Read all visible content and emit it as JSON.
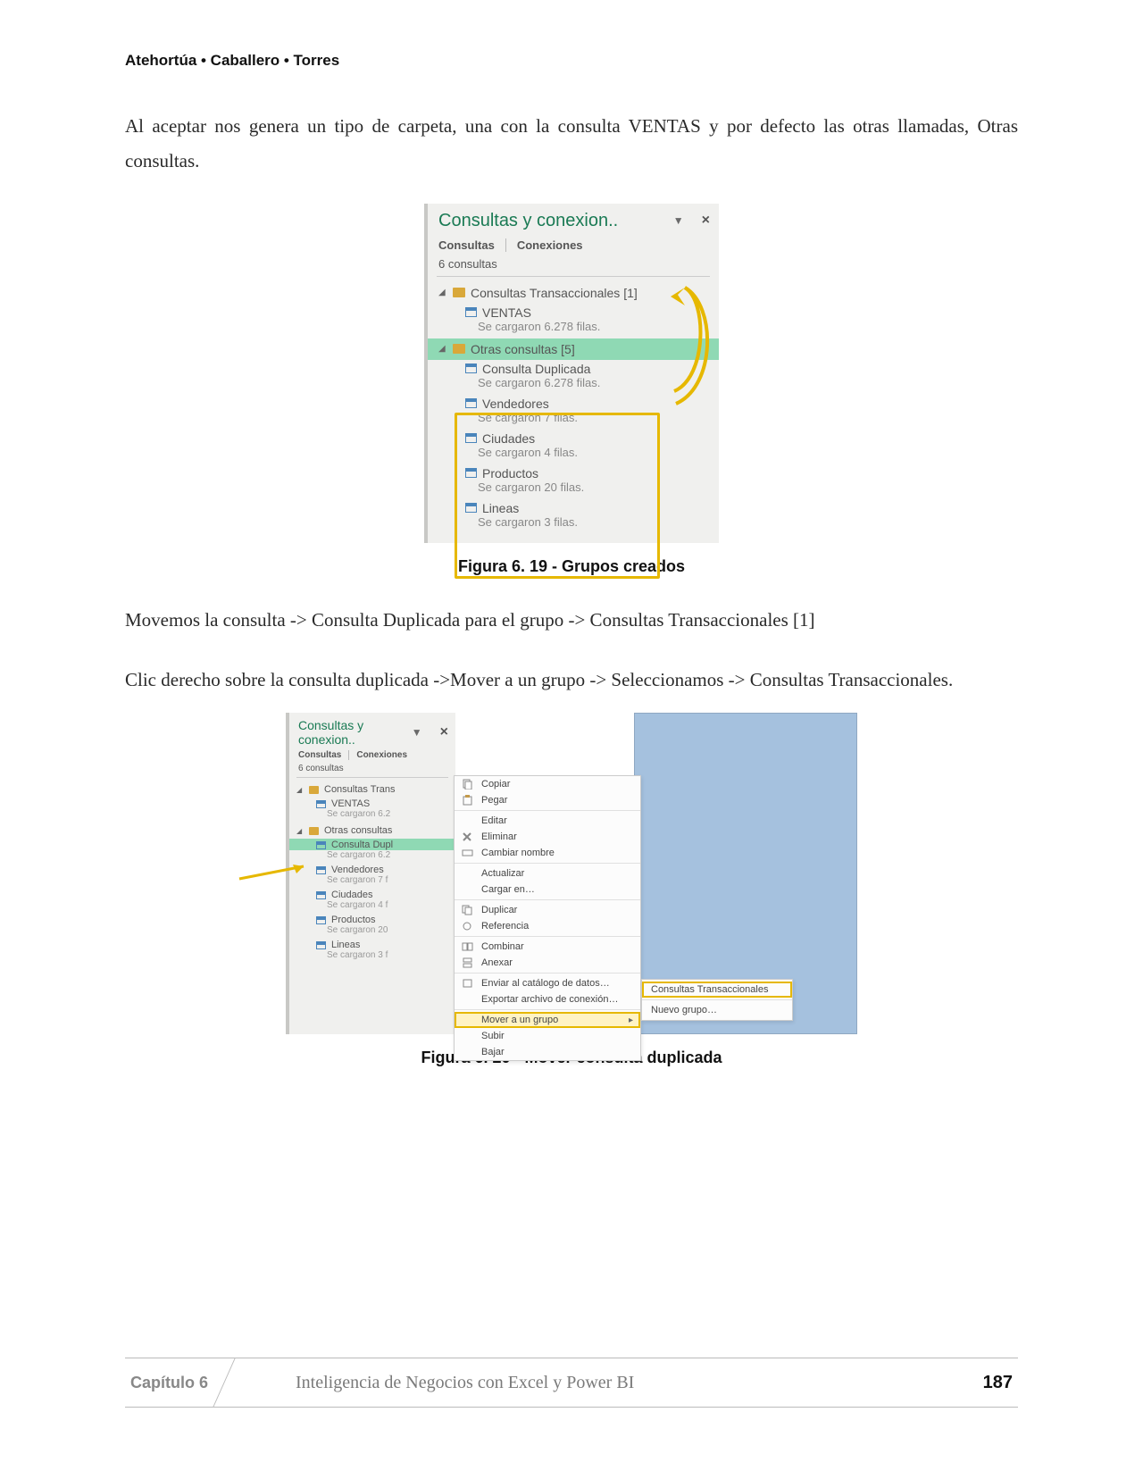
{
  "header": {
    "authors": "Atehortúa • Caballero • Torres"
  },
  "para1": "Al aceptar nos genera un tipo de carpeta, una con la consulta VENTAS y por defecto las otras llamadas, Otras consultas.",
  "para2": "Movemos la consulta -> Consulta Duplicada para el grupo -> Consultas Transaccionales [1]",
  "para3": "Clic derecho sobre la consulta duplicada ->Mover a un grupo -> Seleccionamos -> Consultas Transaccionales.",
  "captions": {
    "fig1": "Figura 6. 19 - Grupos creados",
    "fig2": "Figura 6. 20 - Mover consulta duplicada"
  },
  "panel": {
    "title": "Consultas y conexion..",
    "tabs": {
      "a": "Consultas",
      "b": "Conexiones"
    },
    "count": "6 consultas",
    "groups": [
      {
        "name": "Consultas Transaccionales [1]"
      },
      {
        "name": "Otras consultas [5]"
      }
    ],
    "queries": [
      {
        "name": "VENTAS",
        "status": "Se cargaron 6.278 filas."
      },
      {
        "name": "Consulta Duplicada",
        "status": "Se cargaron 6.278 filas."
      },
      {
        "name": "Vendedores",
        "status": "Se cargaron 7 filas."
      },
      {
        "name": "Ciudades",
        "status": "Se cargaron 4 filas."
      },
      {
        "name": "Productos",
        "status": "Se cargaron 20 filas."
      },
      {
        "name": "Lineas",
        "status": "Se cargaron 3 filas."
      }
    ]
  },
  "panel2": {
    "title": "Consultas y conexion..",
    "tabs": {
      "a": "Consultas",
      "b": "Conexiones"
    },
    "count": "6 consultas",
    "groups": [
      {
        "name": "Consultas Trans"
      },
      {
        "name": "Otras consultas"
      }
    ],
    "queries": [
      {
        "name": "VENTAS",
        "status": "Se cargaron 6.2"
      },
      {
        "name": "Consulta Dupl",
        "status": "Se cargaron 6.2"
      },
      {
        "name": "Vendedores",
        "status": "Se cargaron 7 f"
      },
      {
        "name": "Ciudades",
        "status": "Se cargaron 4 f"
      },
      {
        "name": "Productos",
        "status": "Se cargaron 20"
      },
      {
        "name": "Lineas",
        "status": "Se cargaron 3 f"
      }
    ]
  },
  "menu": {
    "items": [
      "Copiar",
      "Pegar",
      "Editar",
      "Eliminar",
      "Cambiar nombre",
      "Actualizar",
      "Cargar en…",
      "Duplicar",
      "Referencia",
      "Combinar",
      "Anexar",
      "Enviar al catálogo de datos…",
      "Exportar archivo de conexión…",
      "Mover a un grupo",
      "Subir",
      "Bajar"
    ],
    "submenu": [
      "Consultas Transaccionales",
      "Nuevo grupo…"
    ]
  },
  "footer": {
    "chapter": "Capítulo 6",
    "book": "Inteligencia de Negocios con Excel y Power BI",
    "page": "187"
  }
}
